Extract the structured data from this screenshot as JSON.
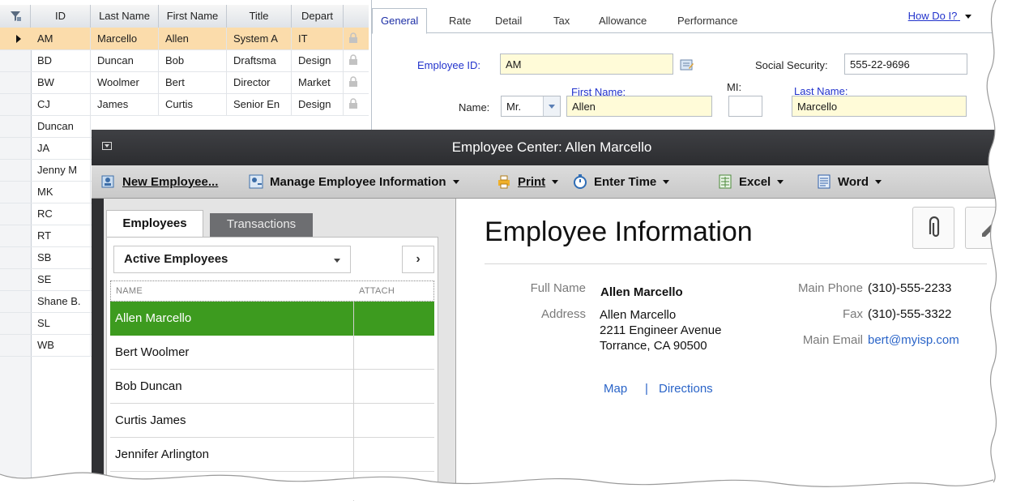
{
  "grid": {
    "columns": [
      "ID",
      "Last Name",
      "First Name",
      "Title",
      "Depart"
    ],
    "rows": [
      {
        "id": "AM",
        "last": "Marcello",
        "first": "Allen",
        "title": "System A",
        "dept": "IT",
        "selected": true
      },
      {
        "id": "BD",
        "last": "Duncan",
        "first": "Bob",
        "title": "Draftsma",
        "dept": "Design"
      },
      {
        "id": "BW",
        "last": "Woolmer",
        "first": "Bert",
        "title": "Director",
        "dept": "Market"
      },
      {
        "id": "CJ",
        "last": "James",
        "first": "Curtis",
        "title": "Senior En",
        "dept": "Design"
      },
      {
        "id": "Duncan"
      },
      {
        "id": "JA"
      },
      {
        "id": "Jenny M"
      },
      {
        "id": "MK"
      },
      {
        "id": "RC"
      },
      {
        "id": "RT"
      },
      {
        "id": "SB"
      },
      {
        "id": "SE"
      },
      {
        "id": "Shane B."
      },
      {
        "id": "SL"
      },
      {
        "id": "WB"
      }
    ]
  },
  "form": {
    "tabs": [
      "General",
      "Rate",
      "Detail",
      "Tax",
      "Allowance",
      "Performance"
    ],
    "active_tab": "General",
    "how_do_i": "How Do I?",
    "employee_id_label": "Employee ID:",
    "employee_id": "AM",
    "ssn_label": "Social Security:",
    "ssn": "555-22-9696",
    "name_label": "Name:",
    "salutation": "Mr.",
    "first_name_label": "First Name:",
    "first_name": "Allen",
    "mi_label": "MI:",
    "mi": "",
    "last_name_label": "Last Name:",
    "last_name": "Marcello"
  },
  "window": {
    "title": "Employee Center: Allen Marcello",
    "toolbar": [
      {
        "label": "New Employee...",
        "icon": "new-employee-icon",
        "caret": false
      },
      {
        "label": "Manage Employee Information",
        "icon": "manage-employee-icon",
        "caret": true
      },
      {
        "label": "Print",
        "icon": "printer-icon",
        "caret": true
      },
      {
        "label": "Enter Time",
        "icon": "stopwatch-icon",
        "caret": true
      },
      {
        "label": "Excel",
        "icon": "excel-icon",
        "caret": true
      },
      {
        "label": "Word",
        "icon": "word-icon",
        "caret": true
      }
    ],
    "panel_tabs": {
      "employees": "Employees",
      "transactions": "Transactions"
    },
    "filter": "Active Employees",
    "next_button": "›",
    "list_headers": {
      "name": "NAME",
      "attach": "ATTACH"
    },
    "employees": [
      "Allen Marcello",
      "Bert Woolmer",
      "Bob Duncan",
      "Curtis James",
      "Jennifer Arlington"
    ],
    "selected_employee": "Allen Marcello"
  },
  "info": {
    "heading": "Employee Information",
    "full_name_label": "Full Name",
    "full_name": "Allen Marcello",
    "address_label": "Address",
    "address_lines": [
      "Allen Marcello",
      "2211 Engineer Avenue",
      "Torrance, CA 90500"
    ],
    "main_phone_label": "Main Phone",
    "main_phone": "(310)-555-2233",
    "fax_label": "Fax",
    "fax": "(310)-555-3322",
    "email_label": "Main Email",
    "email": "bert@myisp.com",
    "map_link": "Map",
    "separator": "|",
    "directions_link": "Directions"
  },
  "colors": {
    "selected_green": "#3d9b1f",
    "grid_selected": "#fbdcab",
    "titlebar": "#2c2d30",
    "link_blue": "#2a64c8"
  }
}
